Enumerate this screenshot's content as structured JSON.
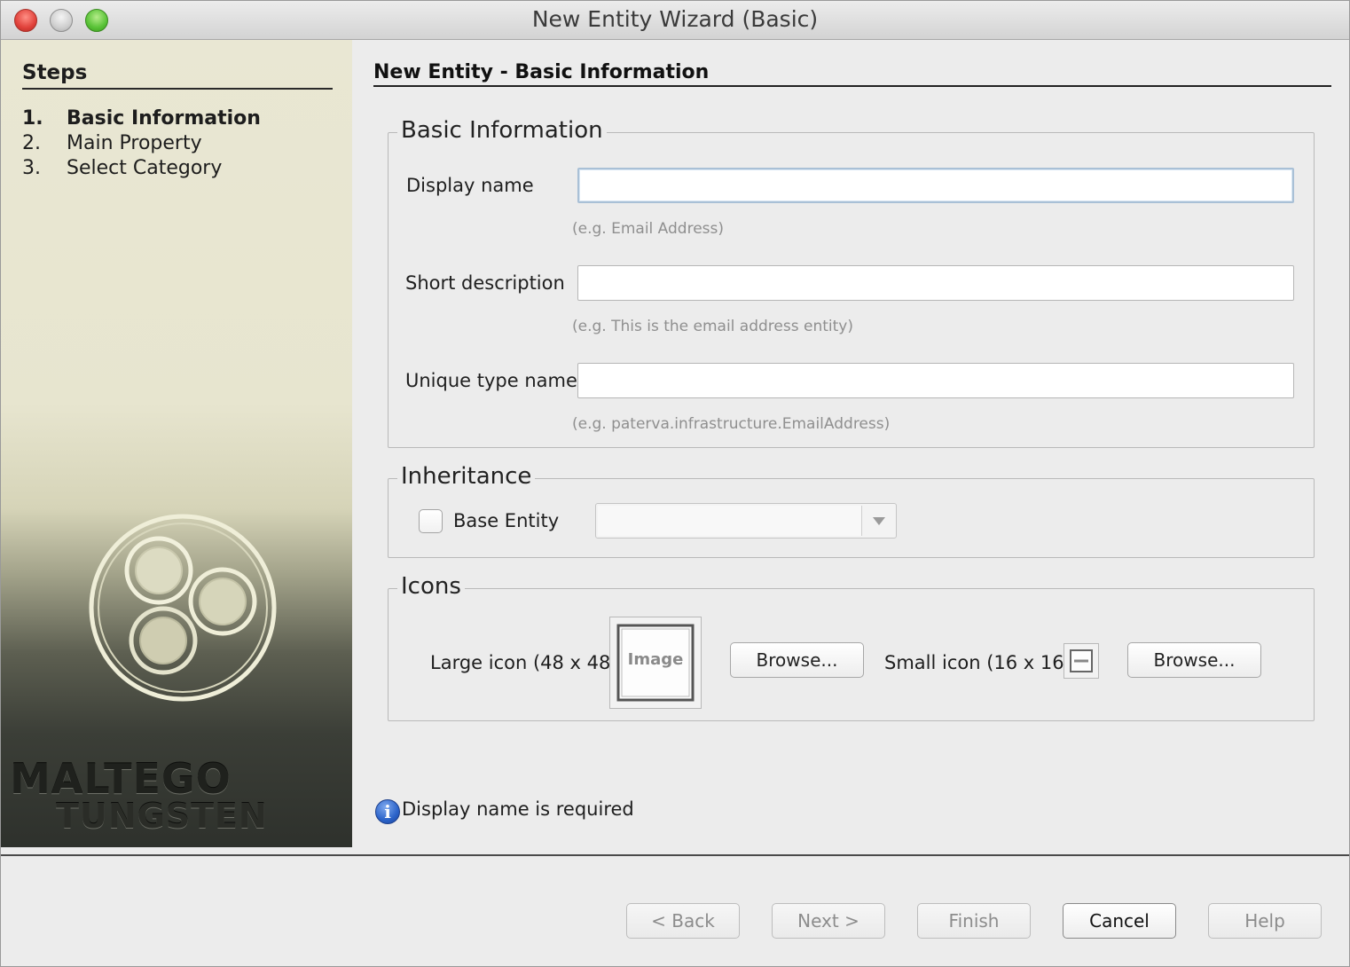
{
  "window": {
    "title": "New Entity Wizard (Basic)"
  },
  "steps": {
    "title": "Steps",
    "items": [
      {
        "num": "1.",
        "label": "Basic Information",
        "active": true
      },
      {
        "num": "2.",
        "label": "Main Property",
        "active": false
      },
      {
        "num": "3.",
        "label": "Select Category",
        "active": false
      }
    ],
    "brand_line1": "MALTEGO",
    "brand_line2": "TUNGSTEN"
  },
  "page": {
    "title": "New Entity - Basic Information"
  },
  "basic_info": {
    "legend": "Basic Information",
    "display_name": {
      "label": "Display name",
      "value": "",
      "hint": "(e.g. Email Address)"
    },
    "short_description": {
      "label": "Short description",
      "value": "",
      "hint": "(e.g. This is the email address entity)"
    },
    "unique_type_name": {
      "label": "Unique type name",
      "value": "",
      "hint": "(e.g. paterva.infrastructure.EmailAddress)"
    }
  },
  "inheritance": {
    "legend": "Inheritance",
    "base_entity_label": "Base Entity",
    "base_entity_checked": false,
    "base_entity_value": ""
  },
  "icons": {
    "legend": "Icons",
    "large_label": "Large icon (48 x 48)",
    "large_placeholder": "Image",
    "small_label": "Small icon (16 x 16)",
    "browse_label": "Browse..."
  },
  "status": {
    "message": "Display name is required"
  },
  "footer": {
    "back": "< Back",
    "next": "Next >",
    "finish": "Finish",
    "cancel": "Cancel",
    "help": "Help"
  }
}
